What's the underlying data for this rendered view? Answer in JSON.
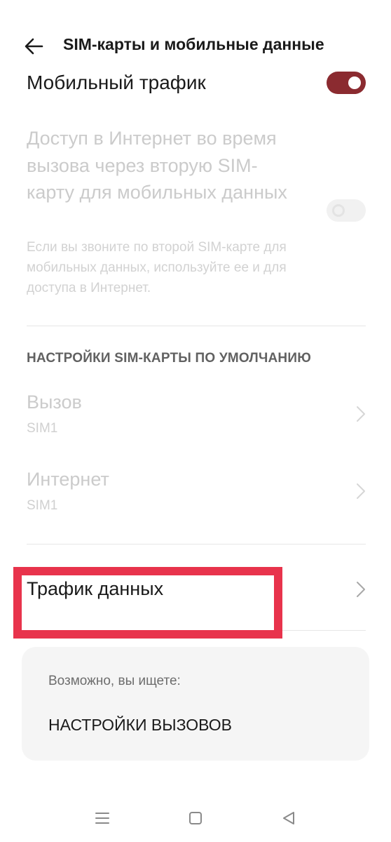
{
  "header": {
    "title": "SIM-карты и мобильные данные",
    "back_icon": "arrow-left-icon"
  },
  "mobile_traffic": {
    "label": "Мобильный трафик",
    "enabled": true,
    "toggle_color": "#8b2b30"
  },
  "dual_sim_data": {
    "title": "Доступ в Интернет во время вызова через вторую SIM-карту для мобильных данных",
    "description": "Если вы звоните по второй SIM-карте для мобильных данных, используйте ее и для доступа в Интернет.",
    "enabled": false,
    "disabled": true
  },
  "default_sim_section": {
    "header": "НАСТРОЙКИ SIM-КАРТЫ ПО УМОЛЧАНИЮ",
    "items": [
      {
        "label": "Вызов",
        "value": "SIM1",
        "disabled": true
      },
      {
        "label": "Интернет",
        "value": "SIM1",
        "disabled": true
      }
    ]
  },
  "data_usage": {
    "label": "Трафик данных",
    "highlight_color": "#e8334c"
  },
  "suggestions": {
    "hint": "Возможно, вы ищете:",
    "link": "НАСТРОЙКИ ВЫЗОВОВ"
  },
  "system_nav": {
    "buttons": [
      "menu-icon",
      "home-icon",
      "back-triangle-icon"
    ]
  }
}
